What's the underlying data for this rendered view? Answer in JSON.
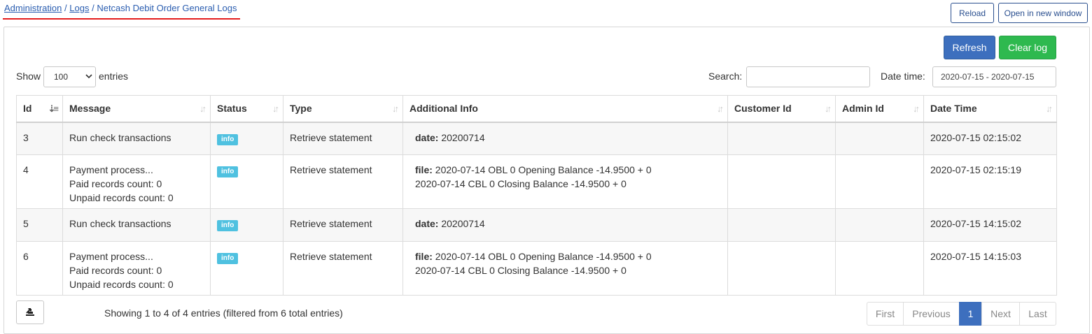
{
  "breadcrumb": {
    "items": [
      "Administration",
      "Logs"
    ],
    "separator": "/",
    "current": "Netcash Debit Order General Logs"
  },
  "header_buttons": {
    "reload": "Reload",
    "open_new_window": "Open in new window"
  },
  "actions": {
    "refresh": "Refresh",
    "clear_log": "Clear log"
  },
  "length": {
    "show": "Show",
    "value": "100",
    "entries": "entries"
  },
  "search": {
    "label": "Search:",
    "value": ""
  },
  "datetime": {
    "label": "Date time:",
    "value": "2020-07-15 - 2020-07-15"
  },
  "table": {
    "columns": [
      "Id",
      "Message",
      "Status",
      "Type",
      "Additional Info",
      "Customer Id",
      "Admin Id",
      "Date Time"
    ],
    "rows": [
      {
        "id": "3",
        "message": [
          "Run check transactions"
        ],
        "status": "info",
        "type": "Retrieve statement",
        "info_key": "date:",
        "info_lines": [
          "20200714"
        ],
        "customer_id": "",
        "admin_id": "",
        "date_time": "2020-07-15 02:15:02"
      },
      {
        "id": "4",
        "message": [
          "Payment process...",
          "Paid records count: 0",
          "Unpaid records count: 0"
        ],
        "status": "info",
        "type": "Retrieve statement",
        "info_key": "file:",
        "info_lines": [
          "2020-07-14 OBL 0 Opening Balance -14.9500 + 0",
          "2020-07-14 CBL 0 Closing Balance -14.9500 + 0"
        ],
        "customer_id": "",
        "admin_id": "",
        "date_time": "2020-07-15 02:15:19"
      },
      {
        "id": "5",
        "message": [
          "Run check transactions"
        ],
        "status": "info",
        "type": "Retrieve statement",
        "info_key": "date:",
        "info_lines": [
          "20200714"
        ],
        "customer_id": "",
        "admin_id": "",
        "date_time": "2020-07-15 14:15:02"
      },
      {
        "id": "6",
        "message": [
          "Payment process...",
          "Paid records count: 0",
          "Unpaid records count: 0"
        ],
        "status": "info",
        "type": "Retrieve statement",
        "info_key": "file:",
        "info_lines": [
          "2020-07-14 OBL 0 Opening Balance -14.9500 + 0",
          "2020-07-14 CBL 0 Closing Balance -14.9500 + 0"
        ],
        "customer_id": "",
        "admin_id": "",
        "date_time": "2020-07-15 14:15:03"
      }
    ]
  },
  "footer": {
    "info": "Showing 1 to 4 of 4 entries (filtered from 6 total entries)"
  },
  "pagination": {
    "first": "First",
    "previous": "Previous",
    "current": "1",
    "next": "Next",
    "last": "Last"
  },
  "colors": {
    "primary": "#3d6fbe",
    "success": "#2eb94f",
    "badge_info": "#4fc1e0",
    "underline": "#e41c1c"
  },
  "icons": {
    "export": "export-icon",
    "sort": "sort-arrows-icon"
  }
}
